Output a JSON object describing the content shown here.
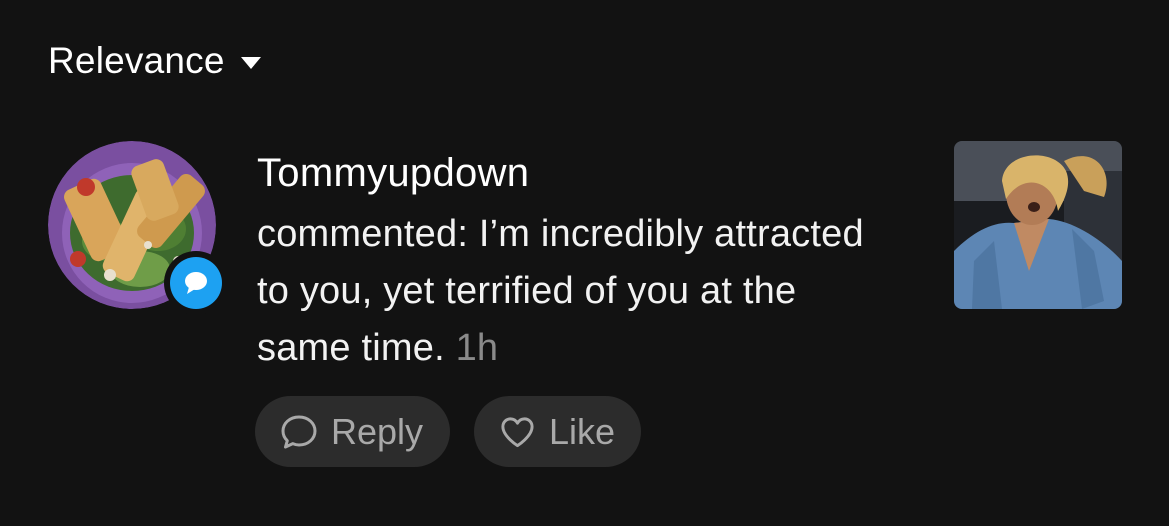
{
  "sort": {
    "label": "Relevance"
  },
  "comment": {
    "username": "Tommyupdown",
    "text": "commented: I’m incredibly attracted to you, yet terrified of you at the same time.",
    "time": "1h"
  },
  "actions": {
    "reply_label": "Reply",
    "like_label": "Like"
  },
  "icons": {
    "sort": "chevron-down-icon",
    "badge": "comment-bubble-icon",
    "reply": "speech-bubble-icon",
    "like": "heart-icon"
  },
  "colors": {
    "background": "#121212",
    "badge": "#1da1f2",
    "pill": "#2c2c2c",
    "muted_text": "#a9a9a9"
  }
}
